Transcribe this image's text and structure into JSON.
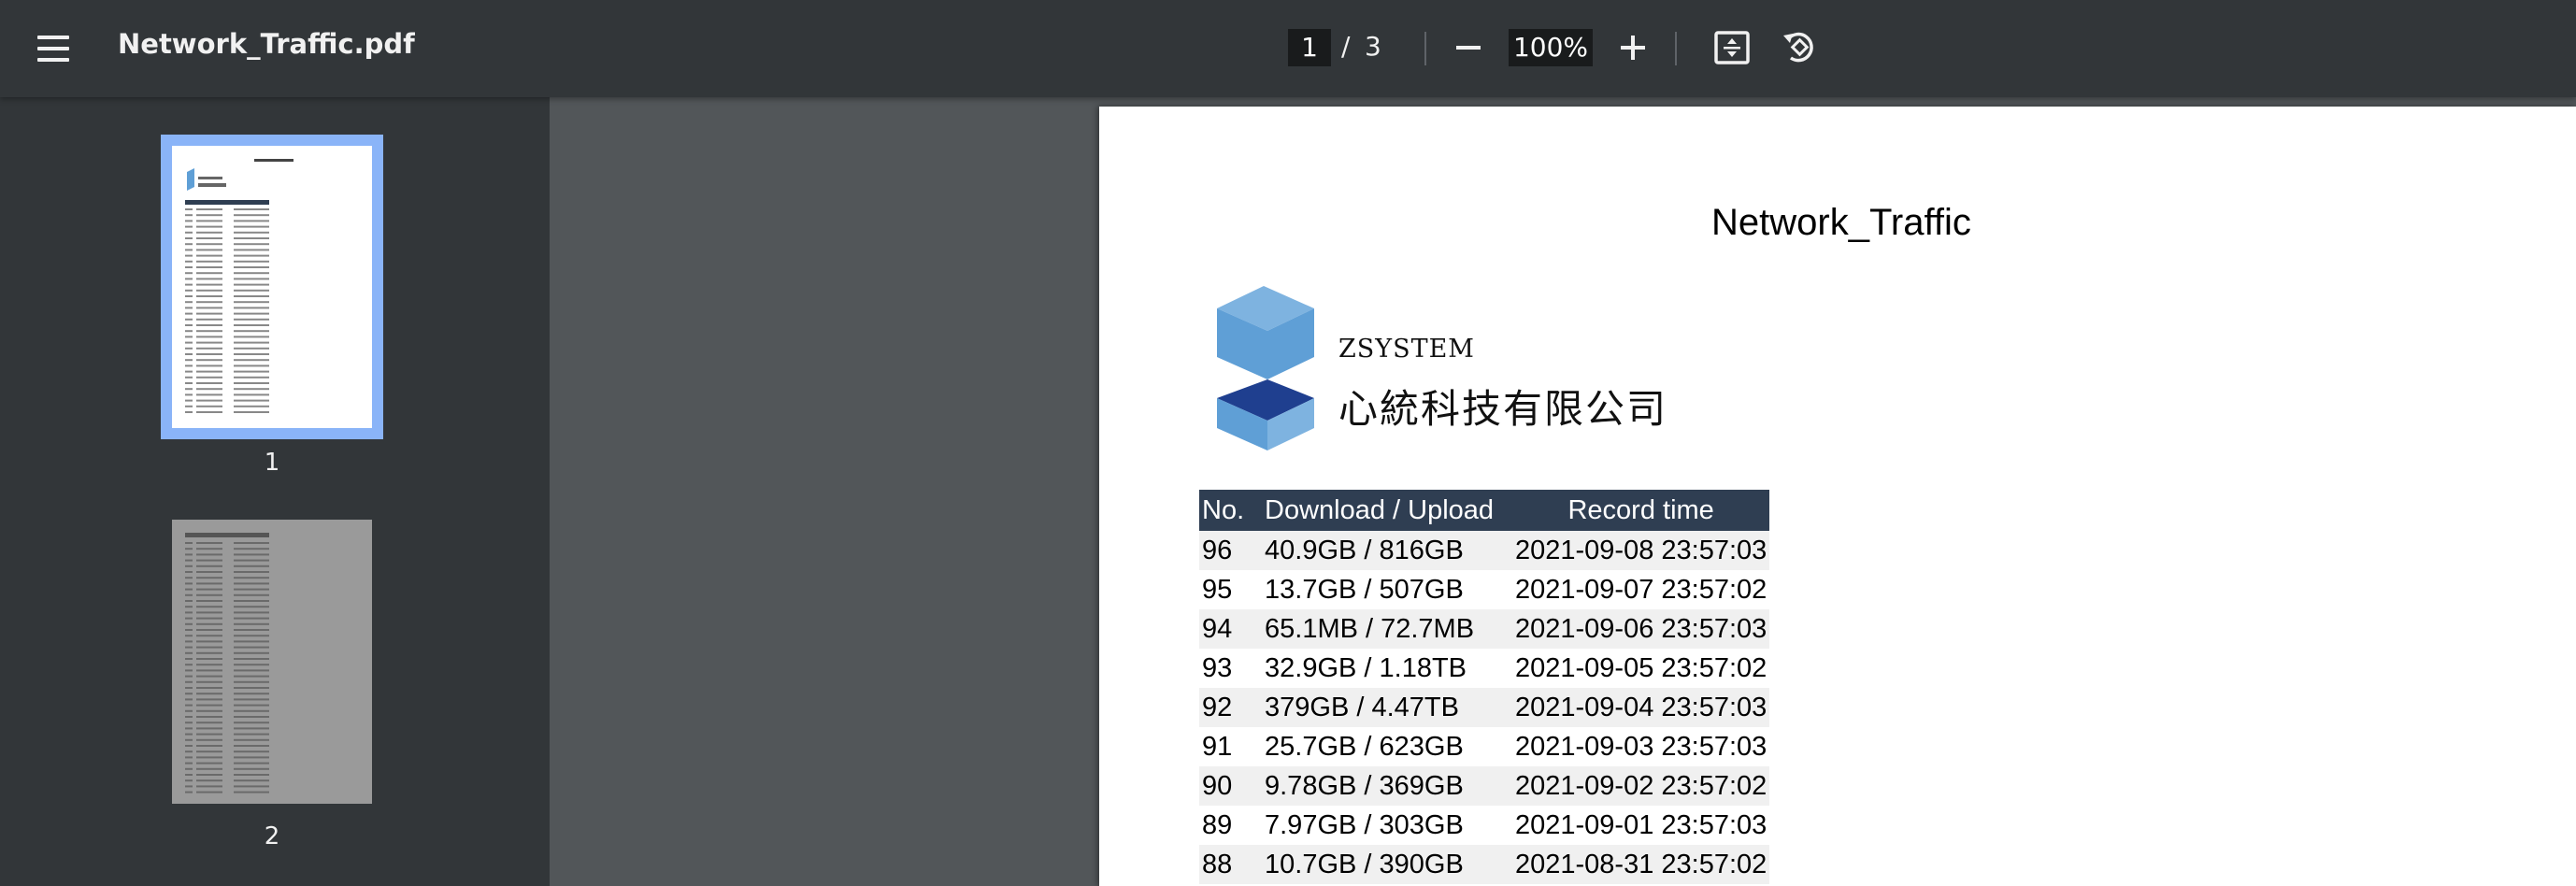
{
  "toolbar": {
    "menu_icon": "hamburger-menu-icon",
    "title": "Network_Traffic.pdf",
    "current_page": "1",
    "page_separator": "/",
    "total_pages": "3",
    "zoom": "100%",
    "icons": [
      "zoom-out-icon",
      "zoom-in-icon",
      "fit-page-icon",
      "rotate-icon"
    ]
  },
  "sidebar": {
    "thumbnails": [
      {
        "label": "1",
        "selected": true
      },
      {
        "label": "2",
        "selected": false
      }
    ]
  },
  "document": {
    "heading": "Network_Traffic",
    "logo": {
      "english": "ZSYSTEM",
      "chinese": "心統科技有限公司"
    },
    "table": {
      "headers": [
        "No.",
        "Download / Upload",
        "Record time"
      ],
      "rows": [
        [
          "96",
          "40.9GB / 816GB",
          "2021-09-08 23:57:03"
        ],
        [
          "95",
          "13.7GB / 507GB",
          "2021-09-07 23:57:02"
        ],
        [
          "94",
          "65.1MB / 72.7MB",
          "2021-09-06 23:57:03"
        ],
        [
          "93",
          "32.9GB / 1.18TB",
          "2021-09-05 23:57:02"
        ],
        [
          "92",
          "379GB / 4.47TB",
          "2021-09-04 23:57:03"
        ],
        [
          "91",
          "25.7GB / 623GB",
          "2021-09-03 23:57:03"
        ],
        [
          "90",
          "9.78GB / 369GB",
          "2021-09-02 23:57:02"
        ],
        [
          "89",
          "7.97GB / 303GB",
          "2021-09-01 23:57:03"
        ],
        [
          "88",
          "10.7GB / 390GB",
          "2021-08-31 23:57:02"
        ]
      ]
    }
  },
  "colors": {
    "toolbar_bg": "#323639",
    "viewer_bg": "#525659",
    "selected_thumb": "#8ab4f8",
    "table_header": "#2f3e52",
    "logo_light_blue": "#5f9fd6",
    "logo_dark_blue": "#1f3f8f"
  }
}
